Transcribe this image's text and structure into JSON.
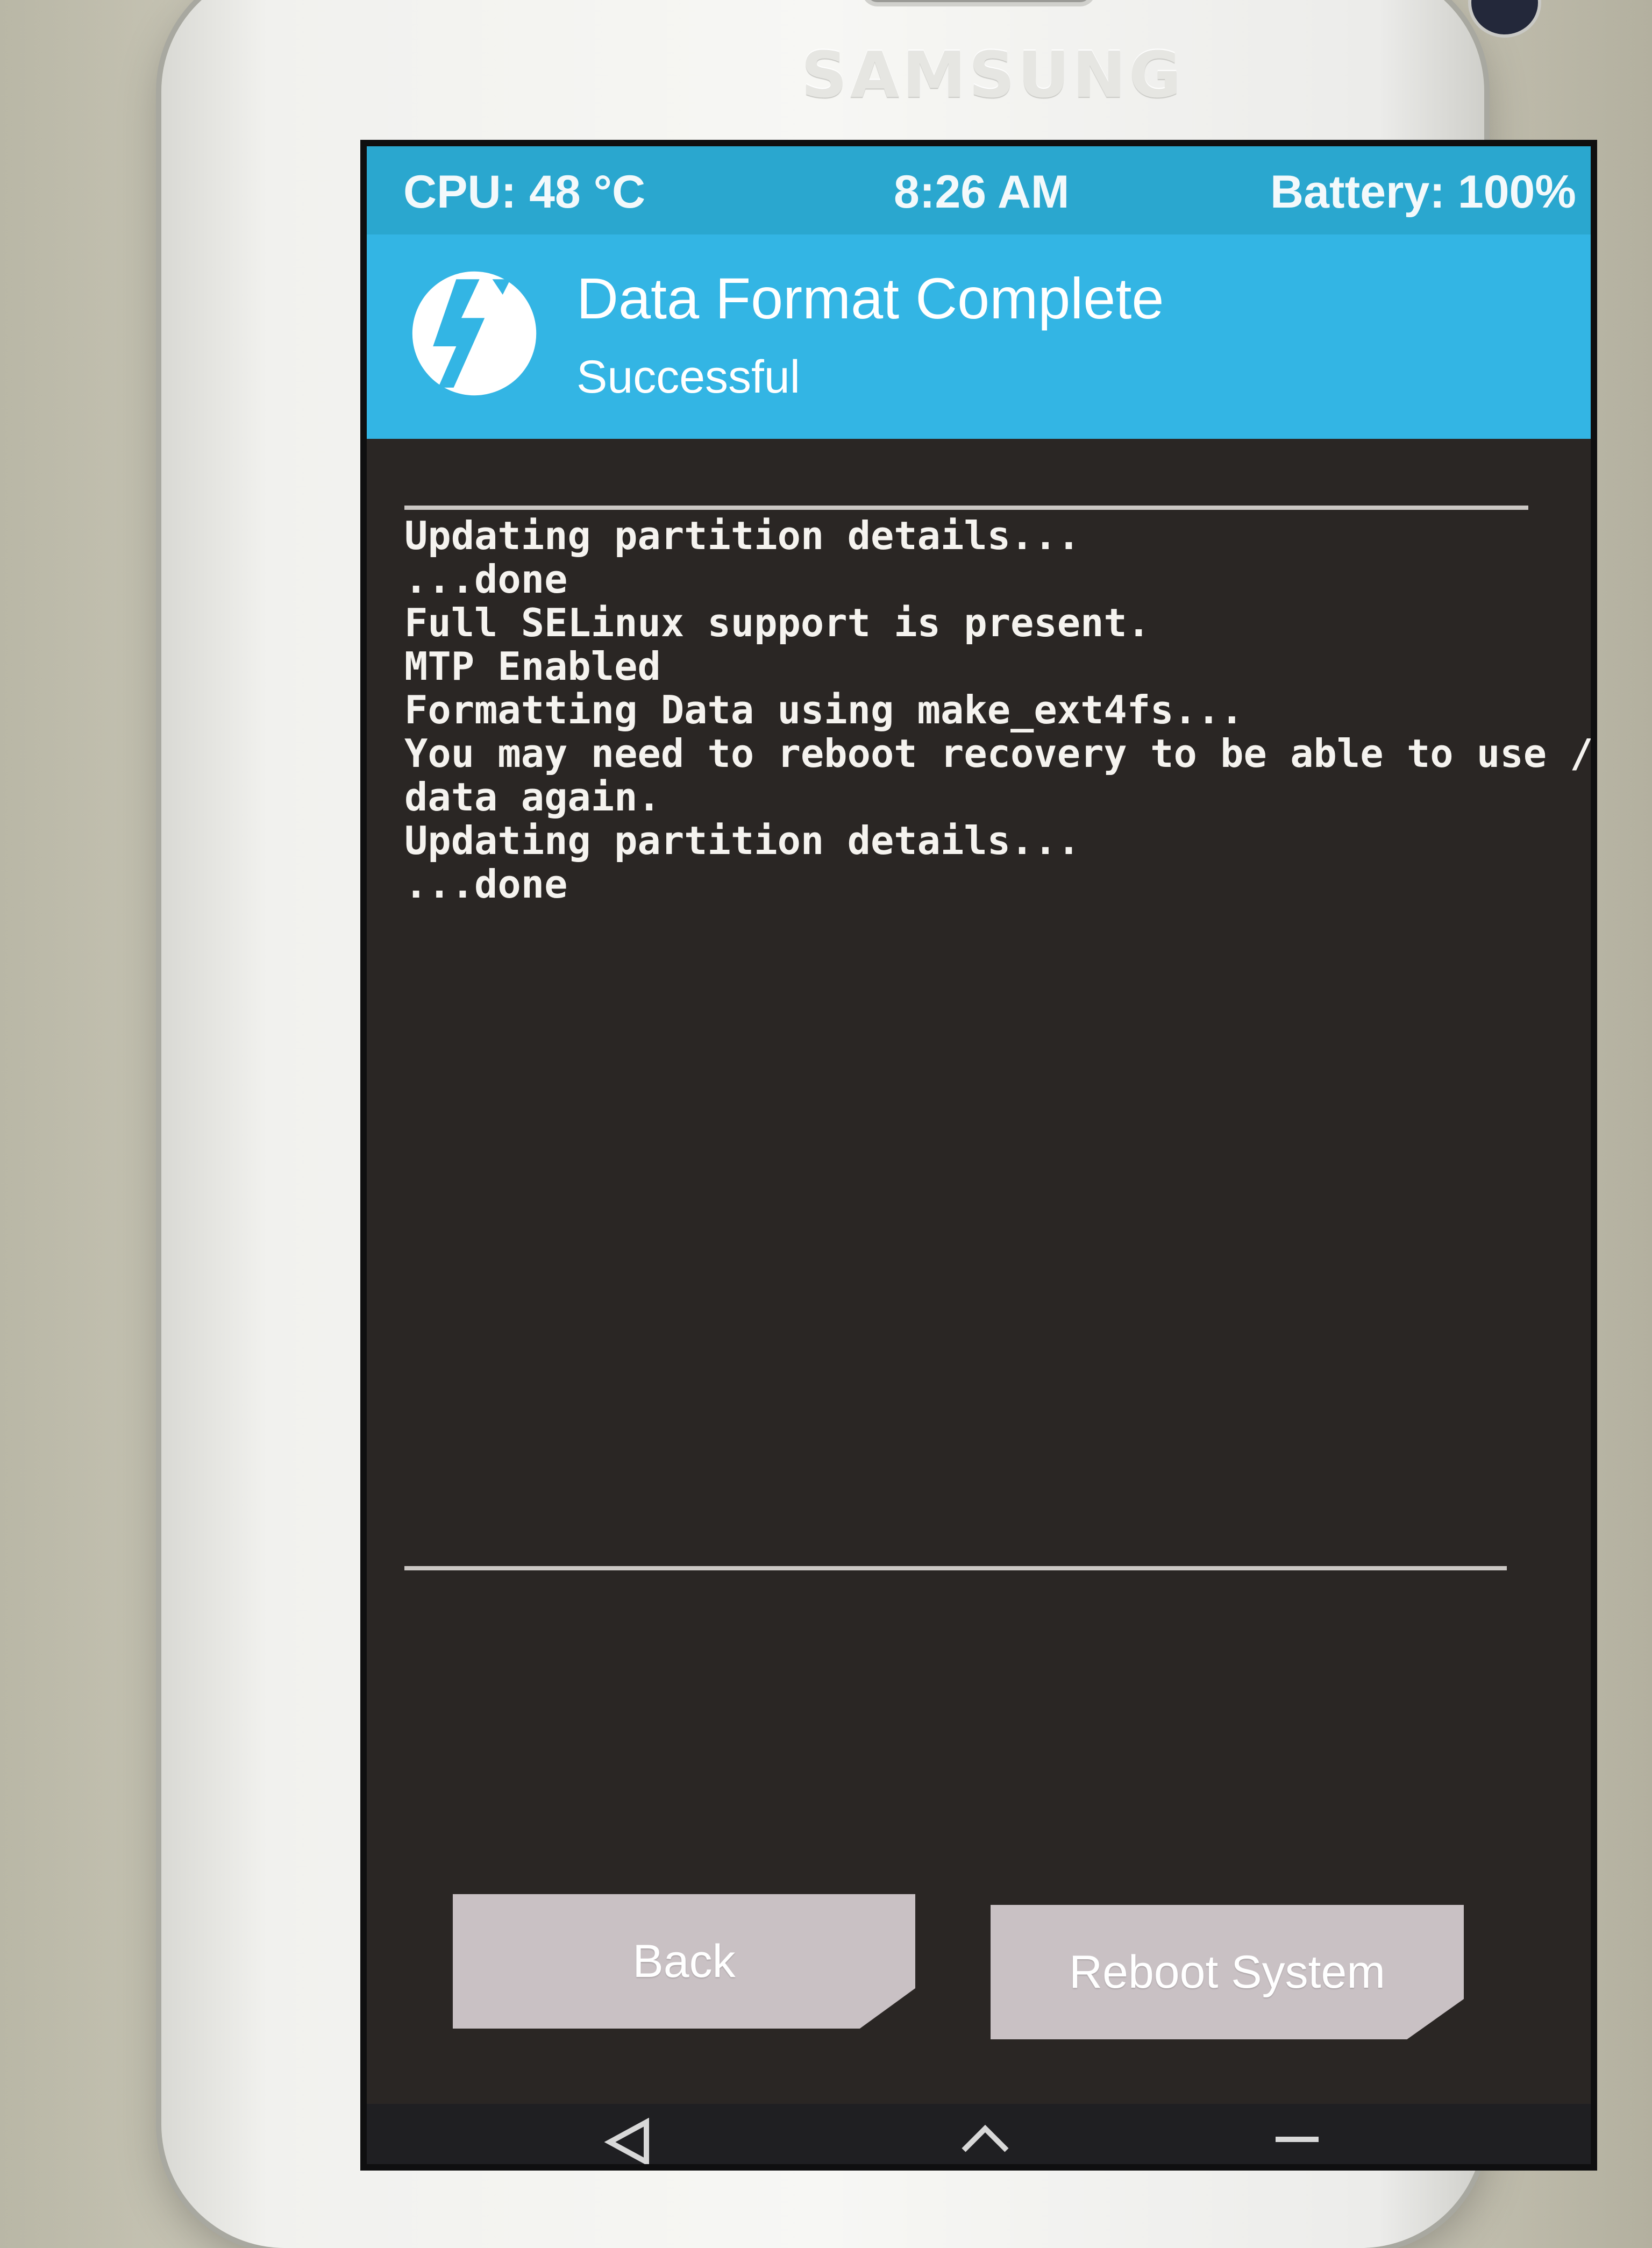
{
  "device": {
    "brand": "SAMSUNG"
  },
  "status_bar": {
    "cpu": "CPU: 48 °C",
    "time": "8:26 AM",
    "battery": "Battery: 100%"
  },
  "header": {
    "title": "Data Format Complete",
    "subtitle": "Successful",
    "logo_icon": "twrp-logo-icon"
  },
  "console": {
    "lines": [
      "Updating partition details...",
      "...done",
      "Full SELinux support is present.",
      "MTP Enabled",
      "Formatting Data using make_ext4fs...",
      "You may need to reboot recovery to be able to use /",
      "data again.",
      "Updating partition details...",
      "...done"
    ]
  },
  "buttons": {
    "back": "Back",
    "reboot": "Reboot System"
  },
  "navbar": {
    "icons": [
      "back-icon",
      "home-icon",
      "menu-icon"
    ]
  },
  "colors": {
    "status_bar": "#2aa7cf",
    "header": "#33b5e4",
    "console_bg": "#2a2624",
    "button": "#c9c1c4"
  }
}
